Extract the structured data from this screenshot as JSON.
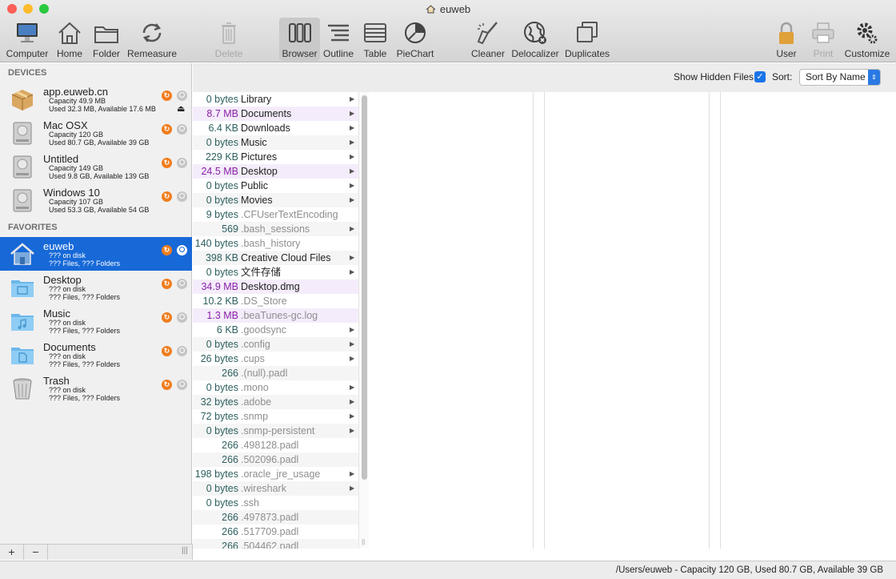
{
  "window": {
    "title": "euweb",
    "traffic": {
      "close": "#fc5f57",
      "minimize": "#fdbc2e",
      "zoom": "#2ac940"
    }
  },
  "toolbar": [
    {
      "label": "Computer",
      "icon": "computer-icon"
    },
    {
      "label": "Home",
      "icon": "home-icon"
    },
    {
      "label": "Folder",
      "icon": "folder-icon"
    },
    {
      "label": "Remeasure",
      "icon": "remeasure-icon"
    },
    {
      "label": "Delete",
      "icon": "trash-icon"
    },
    {
      "label": "Browser",
      "icon": "browser-view-icon"
    },
    {
      "label": "Outline",
      "icon": "outline-view-icon"
    },
    {
      "label": "Table",
      "icon": "table-view-icon"
    },
    {
      "label": "PieChart",
      "icon": "piechart-icon"
    },
    {
      "label": "Cleaner",
      "icon": "broom-icon"
    },
    {
      "label": "Delocalizer",
      "icon": "globe-icon"
    },
    {
      "label": "Duplicates",
      "icon": "duplicates-icon"
    },
    {
      "label": "User",
      "icon": "lock-icon"
    },
    {
      "label": "Print",
      "icon": "printer-icon"
    },
    {
      "label": "Customize",
      "icon": "gear-icon"
    }
  ],
  "sidebar": {
    "devices_header": "DEVICES",
    "favorites_header": "FAVORITES",
    "devices": [
      {
        "name": "app.euweb.cn",
        "line1": "Capacity 49.9 MB",
        "line2": "Used 32.3 MB, Available 17.6 MB",
        "icon": "package-icon"
      },
      {
        "name": "Mac OSX",
        "line1": "Capacity 120 GB",
        "line2": "Used 80.7 GB, Available 39 GB",
        "icon": "hard-drive-icon"
      },
      {
        "name": "Untitled",
        "line1": "Capacity 149 GB",
        "line2": "Used 9.8 GB, Available 139 GB",
        "icon": "hard-drive-icon"
      },
      {
        "name": "Windows 10",
        "line1": "Capacity 107 GB",
        "line2": "Used 53.3 GB, Available 54 GB",
        "icon": "hard-drive-icon"
      }
    ],
    "favorites": [
      {
        "name": "euweb",
        "line1": "??? on disk",
        "line2": "??? Files, ??? Folders",
        "icon": "home-folder-icon"
      },
      {
        "name": "Desktop",
        "line1": "??? on disk",
        "line2": "??? Files, ??? Folders",
        "icon": "desktop-folder-icon"
      },
      {
        "name": "Music",
        "line1": "??? on disk",
        "line2": "??? Files, ??? Folders",
        "icon": "music-folder-icon"
      },
      {
        "name": "Documents",
        "line1": "??? on disk",
        "line2": "??? Files, ??? Folders",
        "icon": "documents-folder-icon"
      },
      {
        "name": "Trash",
        "line1": "??? on disk",
        "line2": "??? Files, ??? Folders",
        "icon": "trash-can-icon"
      }
    ],
    "add_label": "+",
    "remove_label": "−",
    "resize_label": "|||"
  },
  "filter": {
    "show_hidden_label": "Show Hidden Files",
    "show_hidden_checked": true,
    "sort_label": "Sort:",
    "sort_value": "Sort By Name"
  },
  "files": [
    {
      "size": "0 bytes",
      "name": "Library",
      "arrow": true,
      "hidden": false,
      "purple": false
    },
    {
      "size": "8.7 MB",
      "name": "Documents",
      "arrow": true,
      "hidden": false,
      "purple": true
    },
    {
      "size": "6.4 KB",
      "name": "Downloads",
      "arrow": true,
      "hidden": false,
      "purple": false
    },
    {
      "size": "0 bytes",
      "name": "Music",
      "arrow": true,
      "hidden": false,
      "purple": false
    },
    {
      "size": "229 KB",
      "name": "Pictures",
      "arrow": true,
      "hidden": false,
      "purple": false
    },
    {
      "size": "24.5 MB",
      "name": "Desktop",
      "arrow": true,
      "hidden": false,
      "purple": true
    },
    {
      "size": "0 bytes",
      "name": "Public",
      "arrow": true,
      "hidden": false,
      "purple": false
    },
    {
      "size": "0 bytes",
      "name": "Movies",
      "arrow": true,
      "hidden": false,
      "purple": false
    },
    {
      "size": "9 bytes",
      "name": ".CFUserTextEncoding",
      "arrow": false,
      "hidden": true,
      "purple": false
    },
    {
      "size": "569",
      "name": ".bash_sessions",
      "arrow": true,
      "hidden": true,
      "purple": false
    },
    {
      "size": "140 bytes",
      "name": ".bash_history",
      "arrow": false,
      "hidden": true,
      "purple": false
    },
    {
      "size": "398 KB",
      "name": "Creative Cloud Files",
      "arrow": true,
      "hidden": false,
      "purple": false
    },
    {
      "size": "0 bytes",
      "name": "文件存储",
      "arrow": true,
      "hidden": false,
      "purple": false
    },
    {
      "size": "34.9 MB",
      "name": "Desktop.dmg",
      "arrow": false,
      "hidden": false,
      "purple": true
    },
    {
      "size": "10.2 KB",
      "name": ".DS_Store",
      "arrow": false,
      "hidden": true,
      "purple": false
    },
    {
      "size": "1.3 MB",
      "name": ".beaTunes-gc.log",
      "arrow": false,
      "hidden": true,
      "purple": true
    },
    {
      "size": "6 KB",
      "name": ".goodsync",
      "arrow": true,
      "hidden": true,
      "purple": false
    },
    {
      "size": "0 bytes",
      "name": ".config",
      "arrow": true,
      "hidden": true,
      "purple": false
    },
    {
      "size": "26 bytes",
      "name": ".cups",
      "arrow": true,
      "hidden": true,
      "purple": false
    },
    {
      "size": "266",
      "name": ".(null).padl",
      "arrow": false,
      "hidden": true,
      "purple": false
    },
    {
      "size": "0 bytes",
      "name": ".mono",
      "arrow": true,
      "hidden": true,
      "purple": false
    },
    {
      "size": "32 bytes",
      "name": ".adobe",
      "arrow": true,
      "hidden": true,
      "purple": false
    },
    {
      "size": "72 bytes",
      "name": ".snmp",
      "arrow": true,
      "hidden": true,
      "purple": false
    },
    {
      "size": "0 bytes",
      "name": ".snmp-persistent",
      "arrow": true,
      "hidden": true,
      "purple": false
    },
    {
      "size": "266",
      "name": ".498128.padl",
      "arrow": false,
      "hidden": true,
      "purple": false
    },
    {
      "size": "266",
      "name": ".502096.padl",
      "arrow": false,
      "hidden": true,
      "purple": false
    },
    {
      "size": "198 bytes",
      "name": ".oracle_jre_usage",
      "arrow": true,
      "hidden": true,
      "purple": false
    },
    {
      "size": "0 bytes",
      "name": ".wireshark",
      "arrow": true,
      "hidden": true,
      "purple": false
    },
    {
      "size": "0 bytes",
      "name": ".ssh",
      "arrow": false,
      "hidden": true,
      "purple": false
    },
    {
      "size": "266",
      "name": ".497873.padl",
      "arrow": false,
      "hidden": true,
      "purple": false
    },
    {
      "size": "266",
      "name": ".517709.padl",
      "arrow": false,
      "hidden": true,
      "purple": false
    },
    {
      "size": "266",
      "name": ".504462.padl",
      "arrow": false,
      "hidden": true,
      "purple": false
    }
  ],
  "status": "/Users/euweb - Capacity 120 GB, Used 80.7 GB, Available 39 GB"
}
